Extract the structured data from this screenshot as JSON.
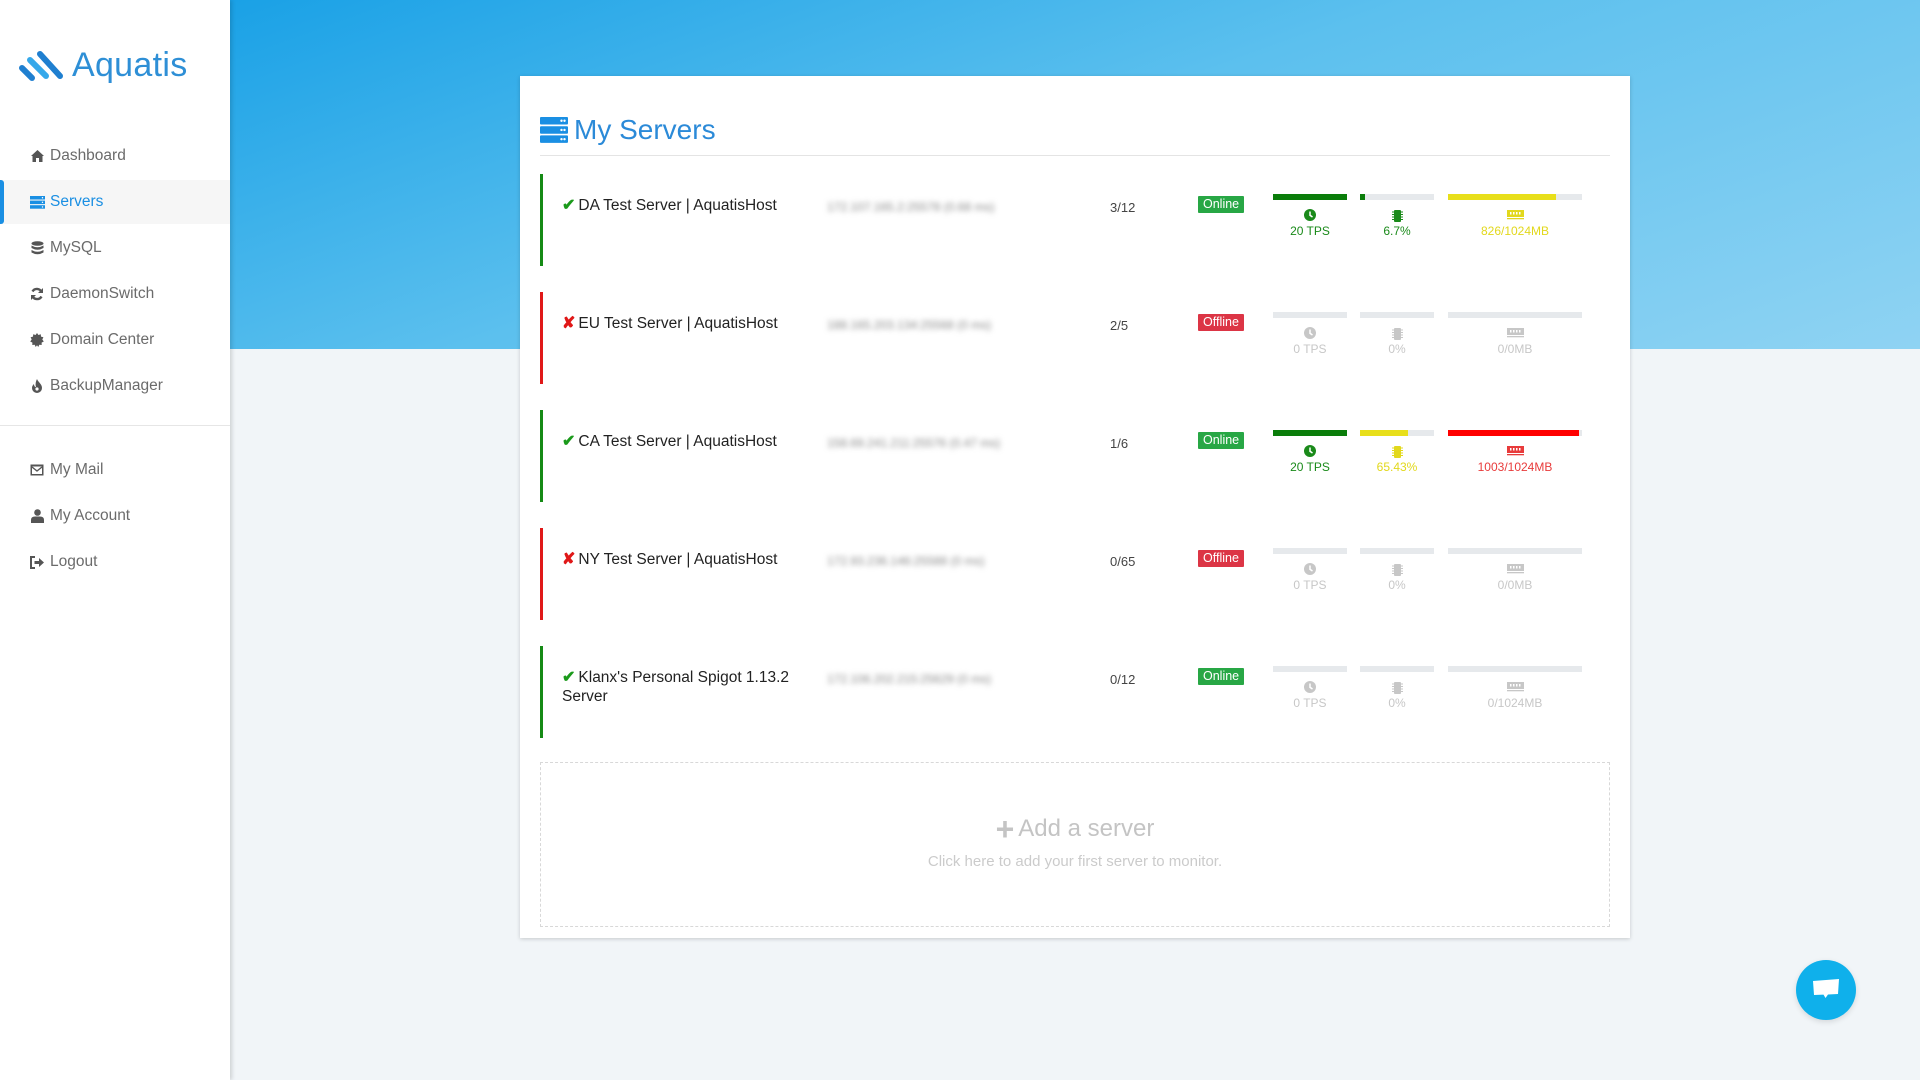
{
  "app": {
    "name": "Aquatis"
  },
  "sidebar": {
    "items": [
      {
        "label": "Dashboard",
        "icon": "home-icon",
        "active": false
      },
      {
        "label": "Servers",
        "icon": "server-icon",
        "active": true
      },
      {
        "label": "MySQL",
        "icon": "database-icon",
        "active": false
      },
      {
        "label": "DaemonSwitch",
        "icon": "refresh-icon",
        "active": false
      },
      {
        "label": "Domain Center",
        "icon": "certificate-icon",
        "active": false
      },
      {
        "label": "BackupManager",
        "icon": "fire-icon",
        "active": false
      }
    ],
    "account_items": [
      {
        "label": "My Mail",
        "icon": "mail-icon"
      },
      {
        "label": "My Account",
        "icon": "user-icon"
      },
      {
        "label": "Logout",
        "icon": "logout-icon"
      }
    ]
  },
  "main": {
    "title": "My Servers",
    "title_icon": "server-icon",
    "servers": [
      {
        "name": "DA Test Server | AquatisHost",
        "status": "online",
        "address": "172.107.165.2:25578 (0.68 ms)",
        "players": "3/12",
        "badge": "Online",
        "tps": {
          "label": "20 TPS",
          "fraction": 1.0,
          "color": "green"
        },
        "cpu": {
          "label": "6.7%",
          "fraction": 0.067,
          "color": "green"
        },
        "ram": {
          "label": "826/1024MB",
          "fraction": 0.807,
          "color": "yellow"
        }
      },
      {
        "name": "EU Test Server | AquatisHost",
        "status": "offline",
        "address": "188.165.203.134:25568 (0 ms)",
        "players": "2/5",
        "badge": "Offline",
        "tps": {
          "label": "0 TPS",
          "fraction": 0,
          "color": "grey"
        },
        "cpu": {
          "label": "0%",
          "fraction": 0,
          "color": "grey"
        },
        "ram": {
          "label": "0/0MB",
          "fraction": 0,
          "color": "grey"
        }
      },
      {
        "name": "CA Test Server | AquatisHost",
        "status": "online",
        "address": "158.69.241.211:25576 (0.47 ms)",
        "players": "1/6",
        "badge": "Online",
        "tps": {
          "label": "20 TPS",
          "fraction": 1.0,
          "color": "green"
        },
        "cpu": {
          "label": "65.43%",
          "fraction": 0.6543,
          "color": "yellow"
        },
        "ram": {
          "label": "1003/1024MB",
          "fraction": 0.98,
          "color": "red"
        }
      },
      {
        "name": "NY Test Server | AquatisHost",
        "status": "offline",
        "address": "172.93.236.146:25588 (0 ms)",
        "players": "0/65",
        "badge": "Offline",
        "tps": {
          "label": "0 TPS",
          "fraction": 0,
          "color": "grey"
        },
        "cpu": {
          "label": "0%",
          "fraction": 0,
          "color": "grey"
        },
        "ram": {
          "label": "0/0MB",
          "fraction": 0,
          "color": "grey"
        }
      },
      {
        "name": "Klanx's Personal Spigot 1.13.2 Server",
        "status": "online",
        "address": "172.106.202.215:25629 (0 ms)",
        "players": "0/12",
        "badge": "Online",
        "tps": {
          "label": "0 TPS",
          "fraction": 0,
          "color": "grey"
        },
        "cpu": {
          "label": "0%",
          "fraction": 0,
          "color": "grey"
        },
        "ram": {
          "label": "0/1024MB",
          "fraction": 0,
          "color": "grey"
        }
      }
    ],
    "add_server": {
      "title": "Add a server",
      "subtitle": "Click here to add your first server to monitor."
    }
  },
  "colors": {
    "accent": "#1a8fe3",
    "online": "#28a745",
    "offline": "#dc3545",
    "green": "#0a7d0a",
    "yellow": "#e8df1a",
    "red": "#ff0000",
    "grey": "#c7c7c7"
  },
  "chat": {
    "icon": "chat-icon"
  }
}
